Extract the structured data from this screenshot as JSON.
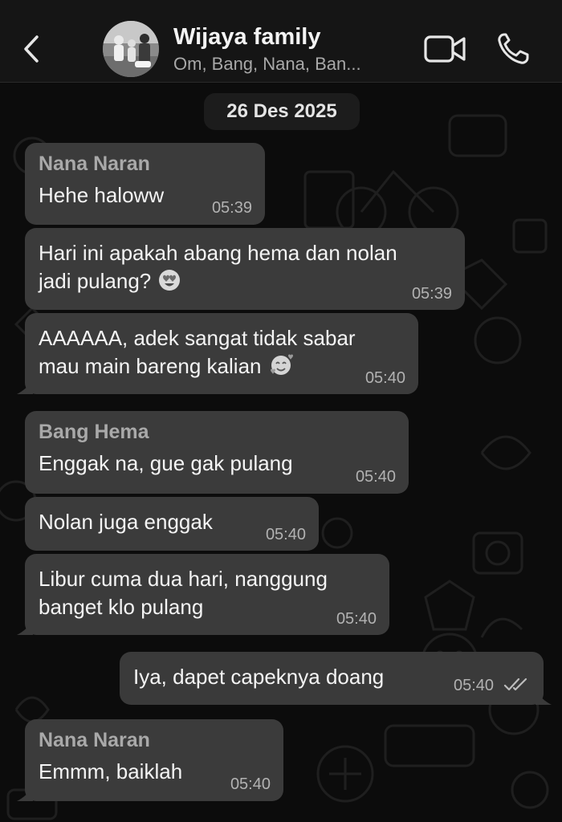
{
  "header": {
    "back_icon": "chevron-left-icon",
    "title": "Wijaya family",
    "subtitle": "Om, Bang, Nana, Ban...",
    "video_icon": "video-call-icon",
    "call_icon": "phone-icon"
  },
  "chat": {
    "date": "26 Des 2025",
    "messages": [
      {
        "sender": "Nana Naran",
        "text": "Hehe haloww",
        "time": "05:39"
      },
      {
        "text_line1": "Hari ini apakah abang hema dan nolan",
        "text_line2": "jadi pulang?",
        "emoji": "heart-eyes-emoji",
        "time": "05:39"
      },
      {
        "text_line1": "AAAAAA, adek sangat tidak sabar",
        "text_line2": "mau main bareng kalian",
        "emoji": "smiling-face-with-hearts-emoji",
        "time": "05:40"
      },
      {
        "sender": "Bang Hema",
        "text": "Enggak na, gue gak pulang",
        "time": "05:40"
      },
      {
        "text": "Nolan juga enggak",
        "time": "05:40"
      },
      {
        "text_line1": "Libur cuma dua hari, nanggung",
        "text_line2": "banget klo pulang",
        "time": "05:40"
      },
      {
        "text": "Iya, dapet capeknya doang",
        "time": "05:40",
        "status_icon": "double-check-icon",
        "outgoing": true
      },
      {
        "sender": "Nana Naran",
        "text": "Emmm, baiklah",
        "time": "05:40"
      }
    ]
  },
  "colors": {
    "header_bg": "#151515",
    "chat_bg": "#0c0c0c",
    "bubble_bg": "#3b3b3b",
    "sender_color": "#a9a9a9",
    "time_color": "#b2b2b2"
  }
}
